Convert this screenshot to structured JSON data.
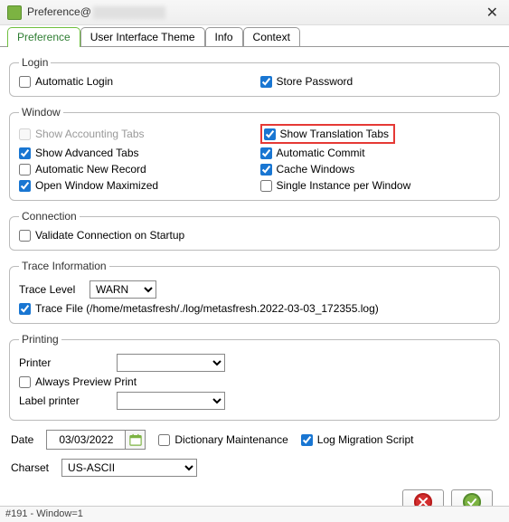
{
  "window": {
    "title_prefix": "Preference@",
    "close_glyph": "✕"
  },
  "tabs": {
    "preference": "Preference",
    "theme": "User Interface Theme",
    "info": "Info",
    "context": "Context"
  },
  "sections": {
    "login": {
      "legend": "Login",
      "automatic_login": "Automatic Login",
      "store_password": "Store Password"
    },
    "window": {
      "legend": "Window",
      "show_accounting_tabs": "Show Accounting Tabs",
      "show_translation_tabs": "Show Translation Tabs",
      "show_advanced_tabs": "Show Advanced Tabs",
      "automatic_commit": "Automatic Commit",
      "automatic_new_record": "Automatic New Record",
      "cache_windows": "Cache Windows",
      "open_window_maximized": "Open Window Maximized",
      "single_instance_per_window": "Single Instance per Window"
    },
    "connection": {
      "legend": "Connection",
      "validate_connection": "Validate Connection on Startup"
    },
    "trace": {
      "legend": "Trace Information",
      "trace_level_label": "Trace Level",
      "trace_level_value": "WARN",
      "trace_file_label": "Trace File (/home/metasfresh/./log/metasfresh.2022-03-03_172355.log)"
    },
    "printing": {
      "legend": "Printing",
      "printer_label": "Printer",
      "always_preview": "Always Preview Print",
      "label_printer_label": "Label printer"
    }
  },
  "bottom": {
    "date_label": "Date",
    "date_value": "03/03/2022",
    "dictionary_maintenance": "Dictionary Maintenance",
    "log_migration_script": "Log Migration Script",
    "charset_label": "Charset",
    "charset_value": "US-ASCII"
  },
  "status": "#191 - Window=1"
}
